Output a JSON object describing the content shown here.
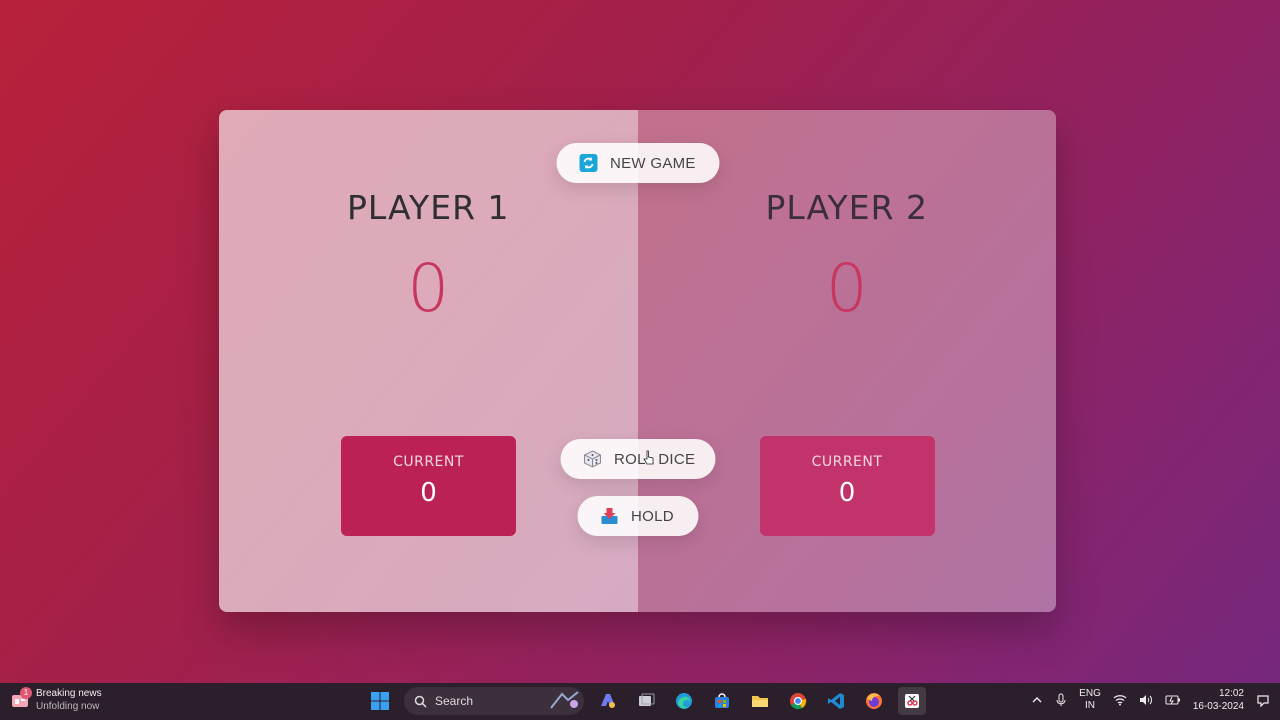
{
  "game": {
    "new_game_label": "NEW GAME",
    "roll_dice_label": "ROLL DICE",
    "hold_label": "HOLD",
    "players": [
      {
        "name": "PLAYER 1",
        "score": "0",
        "current_label": "CURRENT",
        "current_score": "0"
      },
      {
        "name": "PLAYER 2",
        "score": "0",
        "current_label": "CURRENT",
        "current_score": "0"
      }
    ]
  },
  "taskbar": {
    "news_badge": "1",
    "news_title": "Breaking news",
    "news_subtitle": "Unfolding now",
    "search_placeholder": "Search",
    "language_line1": "ENG",
    "language_line2": "IN",
    "time": "12:02",
    "date": "16-03-2024",
    "apps": [
      "windows-start-icon",
      "copilot-icon",
      "task-view-icon",
      "edge-icon",
      "store-icon",
      "file-explorer-icon",
      "chrome-icon",
      "vscode-icon",
      "firefox-icon",
      "snipping-tool-icon"
    ]
  },
  "colors": {
    "accent": "#bb2155",
    "score": "#c7365f"
  }
}
